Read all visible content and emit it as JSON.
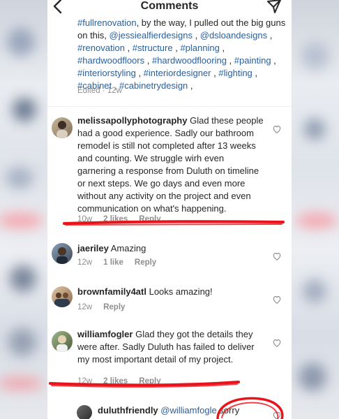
{
  "header": {
    "title": "Comments"
  },
  "caption": {
    "line1_prefix": "",
    "line1_tag": "#fullrenovation",
    "line1_text": ", by the way, I pulled out the big guns on this, ",
    "tags_a": "@jessiealfierdesigns",
    "tags_b": "@dsloandesigns",
    "tags_c": "#renovation",
    "tags_d": "#structure",
    "tags_e": "#planning",
    "tags_f": "#hardwoodfloors",
    "tags_g": "#hardwoodflooring",
    "tags_h": "#painting",
    "tags_i": "#interiorstyling",
    "tags_j": "#interiordesigner",
    "tags_k": "#lighting",
    "tags_l": "#cabinet",
    "tags_m": "#cabinetrydesign",
    "sep": " , ",
    "edited": "Edited · 12w"
  },
  "comments": [
    {
      "username": "melissapollyphotography",
      "text": "Glad these people had a good experience. Sadly our bathroom remodel is still not completed after 13 weeks and counting. We struggle wirh even garnering a response from Duluth on timeline or next steps. We go days and even more without any activity on the project and even communication on what's happening.",
      "time": "10w",
      "likes": "2 likes",
      "reply": "Reply"
    },
    {
      "username": "jaeriley",
      "text": "Amazing",
      "time": "12w",
      "likes": "1 like",
      "reply": "Reply"
    },
    {
      "username": "brownfamily4atl",
      "text": "Looks amazing!",
      "time": "12w",
      "likes": "",
      "reply": "Reply"
    },
    {
      "username": "williamfogler",
      "text": "Glad they got the details they were after. Sadly Duluth has failed to deliver my most important detail of my project.",
      "time": "12w",
      "likes": "2 likes",
      "reply": "Reply"
    }
  ],
  "reply_comment": {
    "username": "duluthfriendly",
    "mention": "@williamfogle",
    "text": " sorry"
  },
  "colors": {
    "link": "#2b5f9a",
    "annotation_red": "#e8141c",
    "meta": "#8e8e8e"
  }
}
